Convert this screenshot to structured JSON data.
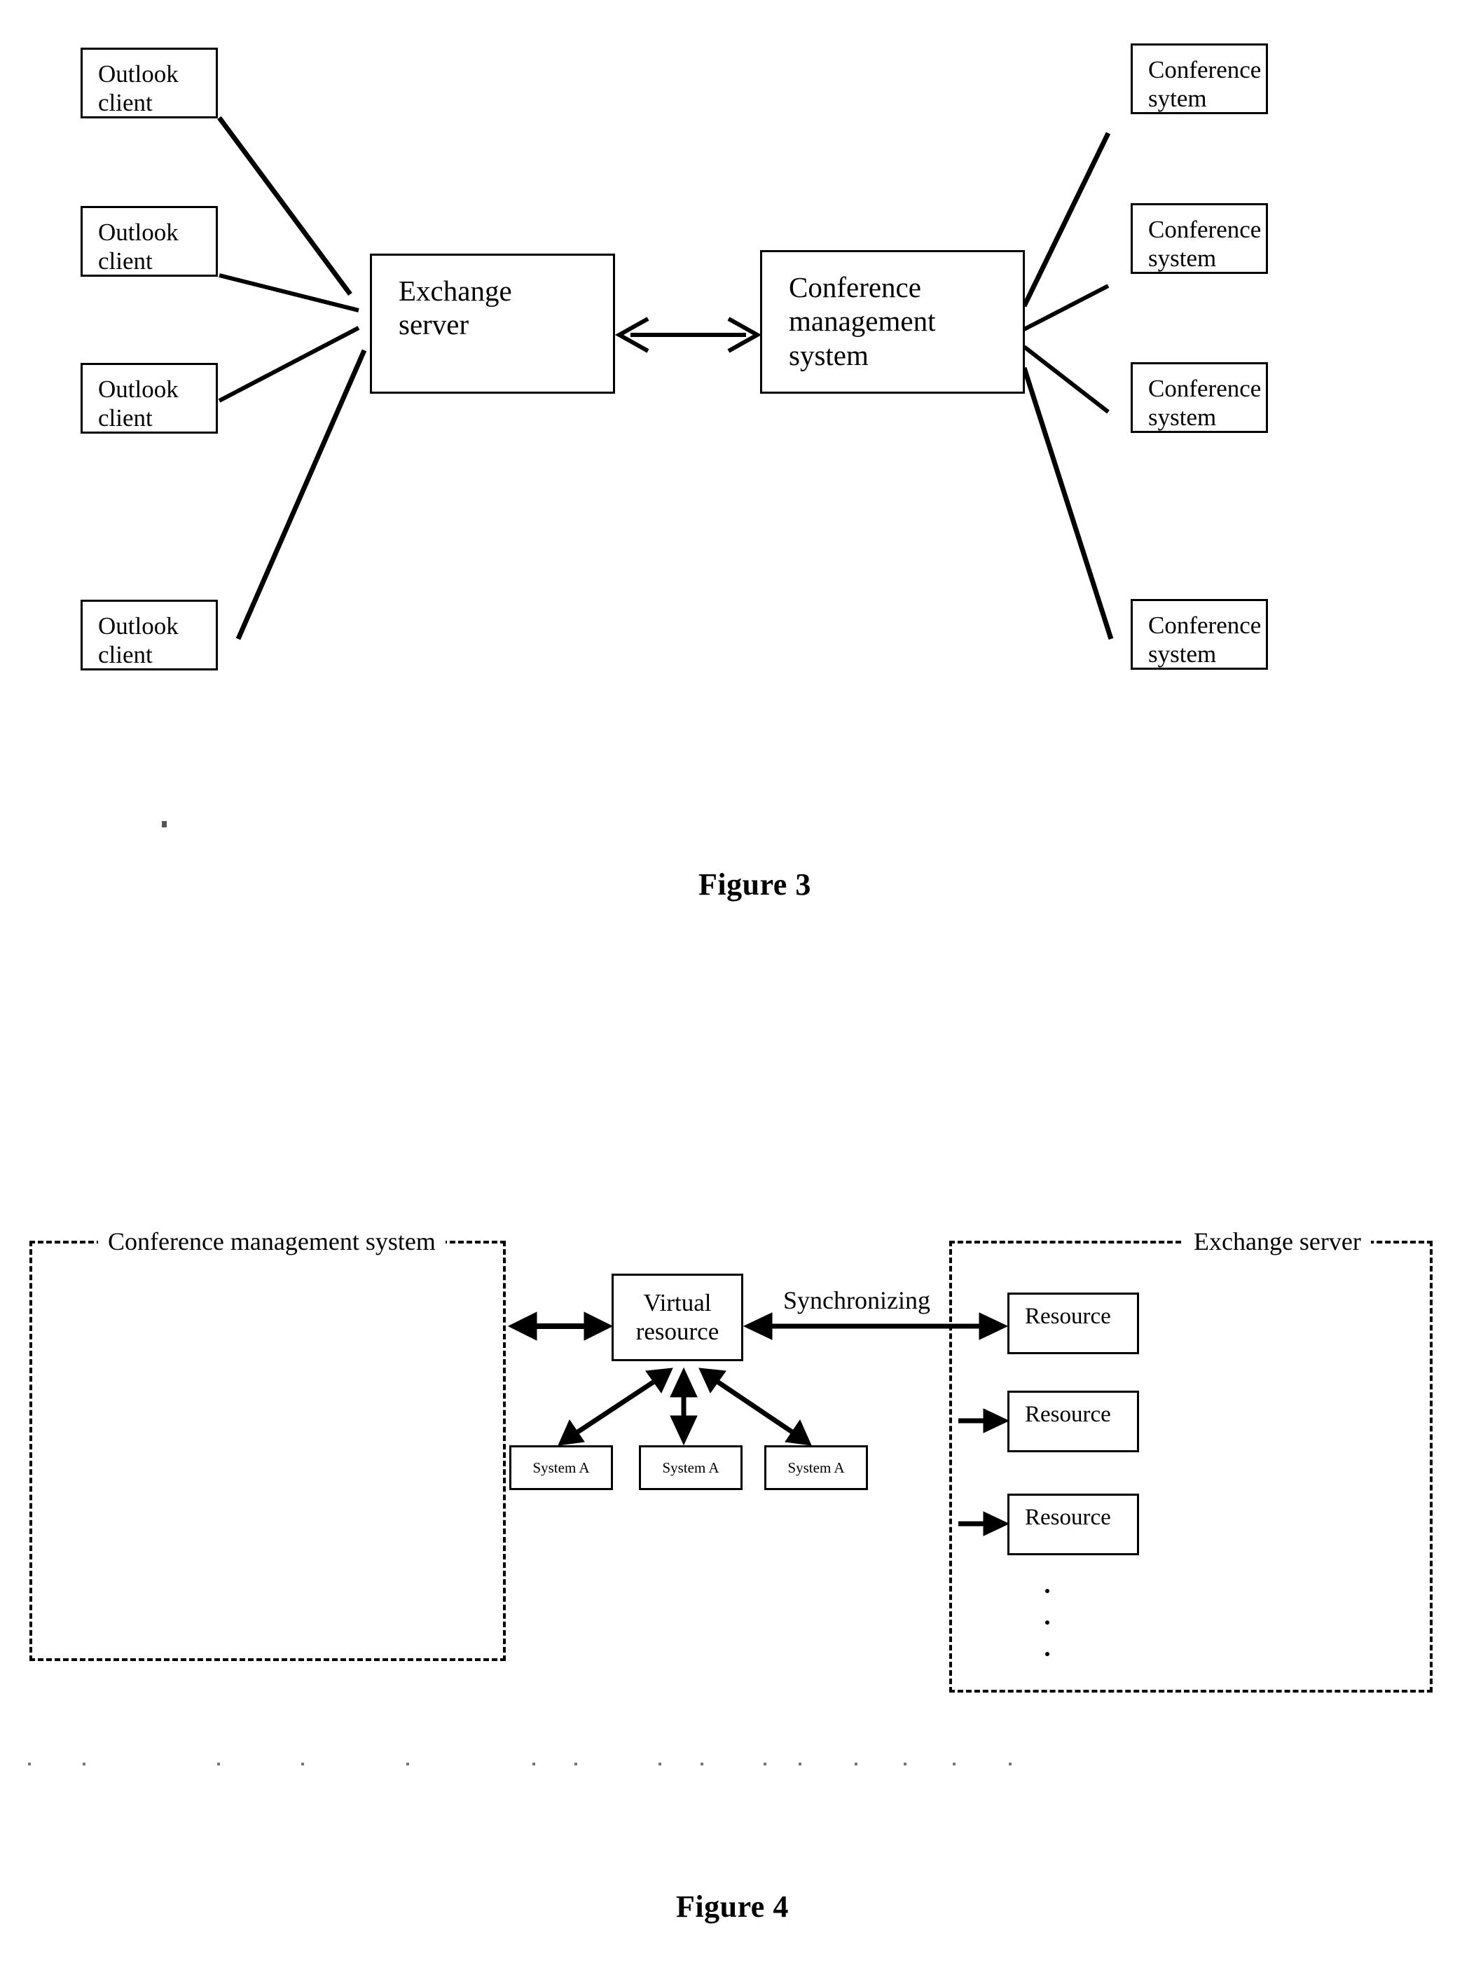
{
  "figure3": {
    "caption": "Figure 3",
    "left_nodes": [
      {
        "label": "Outlook\nclient"
      },
      {
        "label": "Outlook\nclient"
      },
      {
        "label": "Outlook\nclient"
      },
      {
        "label": "Outlook\nclient"
      }
    ],
    "center_left": {
      "label": "Exchange\nserver"
    },
    "center_right": {
      "label": "Conference\nmanagement\nsystem"
    },
    "right_nodes": [
      {
        "label": "Conference\nsytem"
      },
      {
        "label": "Conference\nsystem"
      },
      {
        "label": "Conference\nsystem"
      },
      {
        "label": "Conference\nsystem"
      }
    ],
    "center_link": "bidirectional-arrow"
  },
  "figure4": {
    "caption": "Figure 4",
    "left_region_label": "Conference management system",
    "right_region_label": "Exchange server",
    "virtual_resource": {
      "label": "Virtual\nresource"
    },
    "sync_label": "Synchronizing",
    "system_nodes": [
      {
        "label": "System A"
      },
      {
        "label": "System A"
      },
      {
        "label": "System A"
      }
    ],
    "resource_nodes": [
      {
        "label": "Resource"
      },
      {
        "label": "Resource"
      },
      {
        "label": "Resource"
      }
    ],
    "resource_continuation": "vertical-ellipsis"
  },
  "colors": {
    "ink": "#000000",
    "paper": "#ffffff"
  }
}
